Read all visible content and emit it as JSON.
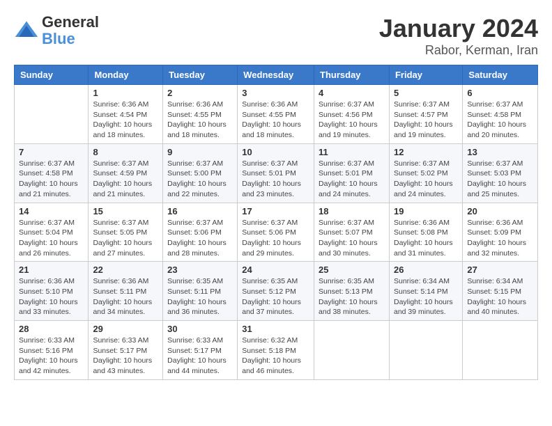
{
  "header": {
    "logo": {
      "general": "General",
      "blue": "Blue"
    },
    "title": "January 2024",
    "subtitle": "Rabor, Kerman, Iran"
  },
  "calendar": {
    "days_of_week": [
      "Sunday",
      "Monday",
      "Tuesday",
      "Wednesday",
      "Thursday",
      "Friday",
      "Saturday"
    ],
    "weeks": [
      [
        {
          "num": "",
          "info": ""
        },
        {
          "num": "1",
          "info": "Sunrise: 6:36 AM\nSunset: 4:54 PM\nDaylight: 10 hours\nand 18 minutes."
        },
        {
          "num": "2",
          "info": "Sunrise: 6:36 AM\nSunset: 4:55 PM\nDaylight: 10 hours\nand 18 minutes."
        },
        {
          "num": "3",
          "info": "Sunrise: 6:36 AM\nSunset: 4:55 PM\nDaylight: 10 hours\nand 18 minutes."
        },
        {
          "num": "4",
          "info": "Sunrise: 6:37 AM\nSunset: 4:56 PM\nDaylight: 10 hours\nand 19 minutes."
        },
        {
          "num": "5",
          "info": "Sunrise: 6:37 AM\nSunset: 4:57 PM\nDaylight: 10 hours\nand 19 minutes."
        },
        {
          "num": "6",
          "info": "Sunrise: 6:37 AM\nSunset: 4:58 PM\nDaylight: 10 hours\nand 20 minutes."
        }
      ],
      [
        {
          "num": "7",
          "info": "Sunrise: 6:37 AM\nSunset: 4:58 PM\nDaylight: 10 hours\nand 21 minutes."
        },
        {
          "num": "8",
          "info": "Sunrise: 6:37 AM\nSunset: 4:59 PM\nDaylight: 10 hours\nand 21 minutes."
        },
        {
          "num": "9",
          "info": "Sunrise: 6:37 AM\nSunset: 5:00 PM\nDaylight: 10 hours\nand 22 minutes."
        },
        {
          "num": "10",
          "info": "Sunrise: 6:37 AM\nSunset: 5:01 PM\nDaylight: 10 hours\nand 23 minutes."
        },
        {
          "num": "11",
          "info": "Sunrise: 6:37 AM\nSunset: 5:01 PM\nDaylight: 10 hours\nand 24 minutes."
        },
        {
          "num": "12",
          "info": "Sunrise: 6:37 AM\nSunset: 5:02 PM\nDaylight: 10 hours\nand 24 minutes."
        },
        {
          "num": "13",
          "info": "Sunrise: 6:37 AM\nSunset: 5:03 PM\nDaylight: 10 hours\nand 25 minutes."
        }
      ],
      [
        {
          "num": "14",
          "info": "Sunrise: 6:37 AM\nSunset: 5:04 PM\nDaylight: 10 hours\nand 26 minutes."
        },
        {
          "num": "15",
          "info": "Sunrise: 6:37 AM\nSunset: 5:05 PM\nDaylight: 10 hours\nand 27 minutes."
        },
        {
          "num": "16",
          "info": "Sunrise: 6:37 AM\nSunset: 5:06 PM\nDaylight: 10 hours\nand 28 minutes."
        },
        {
          "num": "17",
          "info": "Sunrise: 6:37 AM\nSunset: 5:06 PM\nDaylight: 10 hours\nand 29 minutes."
        },
        {
          "num": "18",
          "info": "Sunrise: 6:37 AM\nSunset: 5:07 PM\nDaylight: 10 hours\nand 30 minutes."
        },
        {
          "num": "19",
          "info": "Sunrise: 6:36 AM\nSunset: 5:08 PM\nDaylight: 10 hours\nand 31 minutes."
        },
        {
          "num": "20",
          "info": "Sunrise: 6:36 AM\nSunset: 5:09 PM\nDaylight: 10 hours\nand 32 minutes."
        }
      ],
      [
        {
          "num": "21",
          "info": "Sunrise: 6:36 AM\nSunset: 5:10 PM\nDaylight: 10 hours\nand 33 minutes."
        },
        {
          "num": "22",
          "info": "Sunrise: 6:36 AM\nSunset: 5:11 PM\nDaylight: 10 hours\nand 34 minutes."
        },
        {
          "num": "23",
          "info": "Sunrise: 6:35 AM\nSunset: 5:11 PM\nDaylight: 10 hours\nand 36 minutes."
        },
        {
          "num": "24",
          "info": "Sunrise: 6:35 AM\nSunset: 5:12 PM\nDaylight: 10 hours\nand 37 minutes."
        },
        {
          "num": "25",
          "info": "Sunrise: 6:35 AM\nSunset: 5:13 PM\nDaylight: 10 hours\nand 38 minutes."
        },
        {
          "num": "26",
          "info": "Sunrise: 6:34 AM\nSunset: 5:14 PM\nDaylight: 10 hours\nand 39 minutes."
        },
        {
          "num": "27",
          "info": "Sunrise: 6:34 AM\nSunset: 5:15 PM\nDaylight: 10 hours\nand 40 minutes."
        }
      ],
      [
        {
          "num": "28",
          "info": "Sunrise: 6:33 AM\nSunset: 5:16 PM\nDaylight: 10 hours\nand 42 minutes."
        },
        {
          "num": "29",
          "info": "Sunrise: 6:33 AM\nSunset: 5:17 PM\nDaylight: 10 hours\nand 43 minutes."
        },
        {
          "num": "30",
          "info": "Sunrise: 6:33 AM\nSunset: 5:17 PM\nDaylight: 10 hours\nand 44 minutes."
        },
        {
          "num": "31",
          "info": "Sunrise: 6:32 AM\nSunset: 5:18 PM\nDaylight: 10 hours\nand 46 minutes."
        },
        {
          "num": "",
          "info": ""
        },
        {
          "num": "",
          "info": ""
        },
        {
          "num": "",
          "info": ""
        }
      ]
    ]
  }
}
